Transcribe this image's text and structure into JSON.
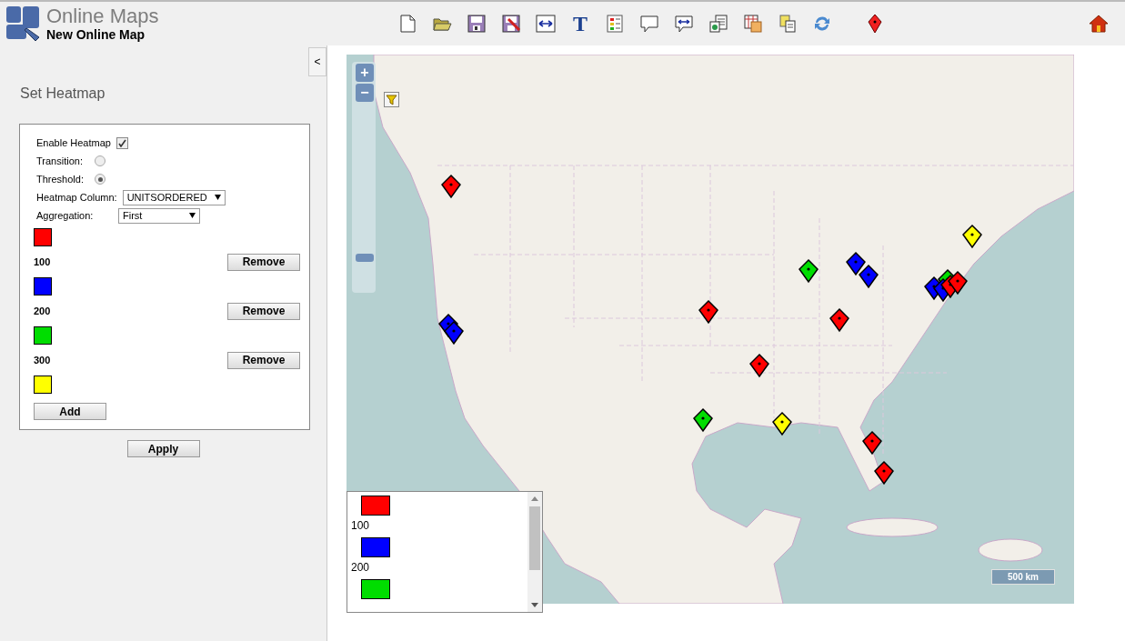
{
  "app": {
    "title": "Online Maps",
    "document": "New Online Map"
  },
  "toolbar": [
    {
      "kind": "new"
    },
    {
      "kind": "open"
    },
    {
      "kind": "save"
    },
    {
      "kind": "save-as"
    },
    {
      "kind": "resize"
    },
    {
      "kind": "text",
      "glyph": "T"
    },
    {
      "kind": "legend"
    },
    {
      "kind": "callout"
    },
    {
      "kind": "callout-arrows"
    },
    {
      "kind": "export"
    },
    {
      "kind": "table-image"
    },
    {
      "kind": "copy"
    },
    {
      "kind": "refresh"
    },
    {
      "kind": "pin"
    },
    {
      "kind": "home"
    }
  ],
  "sidebar": {
    "collapse": "<",
    "title": "Set Heatmap",
    "enable": {
      "label": "Enable Heatmap",
      "checked": true
    },
    "modes": [
      {
        "label": "Transition:",
        "selected": false
      },
      {
        "label": "Threshold:",
        "selected": true
      }
    ],
    "column": {
      "label": "Heatmap Column:",
      "value": "UNITSORDERED"
    },
    "aggregation": {
      "label": "Aggregation:",
      "value": "First"
    },
    "levels": [
      {
        "color": "#ff0000",
        "value": "100",
        "remove": "Remove"
      },
      {
        "color": "#0000ff",
        "value": "200",
        "remove": "Remove"
      },
      {
        "color": "#00dd00",
        "value": "300",
        "remove": "Remove"
      },
      {
        "color": "#ffff00"
      }
    ],
    "add": "Add",
    "apply": "Apply"
  },
  "map": {
    "zoom_in": "+",
    "zoom_out": "−",
    "scale": "500 km",
    "legend": [
      {
        "color": "#ff0000",
        "value": "100"
      },
      {
        "color": "#0000ff",
        "value": "200"
      },
      {
        "color": "#00dd00"
      }
    ]
  }
}
